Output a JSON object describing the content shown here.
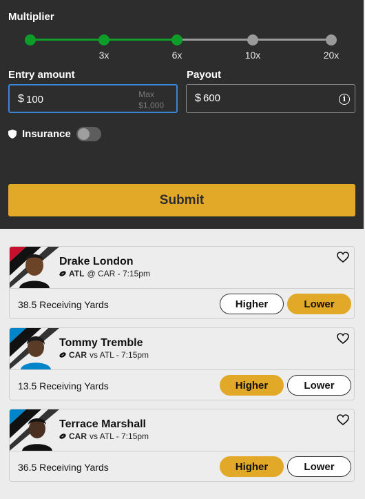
{
  "multiplier": {
    "label": "Multiplier",
    "ticks": [
      "3x",
      "6x",
      "10x",
      "20x"
    ],
    "selected": "6x"
  },
  "entry": {
    "label": "Entry amount",
    "currency": "$",
    "value": "100",
    "max_label": "Max",
    "max_value": "$1,000"
  },
  "payout": {
    "label": "Payout",
    "currency": "$",
    "value": "600",
    "info_glyph": "i"
  },
  "insurance": {
    "label": "Insurance",
    "enabled": false
  },
  "submit_label": "Submit",
  "colors": {
    "accent": "#e2a928",
    "active_green": "#0f9d2a",
    "panel_bg": "#2d2d2d"
  },
  "props": [
    {
      "name": "Drake London",
      "team": "ATL",
      "matchup": "@ CAR - 7:15pm",
      "stat": "38.5 Receiving Yards",
      "higher": "Higher",
      "lower": "Lower",
      "selected": "lower"
    },
    {
      "name": "Tommy Tremble",
      "team": "CAR",
      "matchup": "vs ATL - 7:15pm",
      "stat": "13.5 Receiving Yards",
      "higher": "Higher",
      "lower": "Lower",
      "selected": "higher"
    },
    {
      "name": "Terrace Marshall",
      "team": "CAR",
      "matchup": "vs ATL - 7:15pm",
      "stat": "36.5 Receiving Yards",
      "higher": "Higher",
      "lower": "Lower",
      "selected": "higher"
    }
  ]
}
